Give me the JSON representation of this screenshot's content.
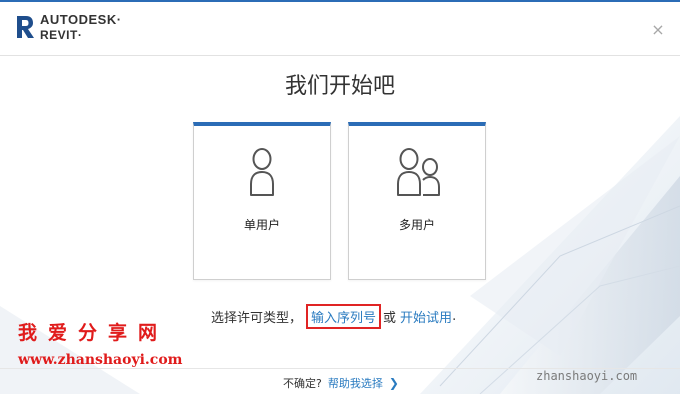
{
  "header": {
    "brand_line1": "AUTODESK·",
    "brand_line2": "REVIT·",
    "close_glyph": "×",
    "accent_color": "#2b6cb6",
    "logo_icon": "revit-r-icon"
  },
  "main": {
    "title": "我们开始吧",
    "cards": [
      {
        "label": "单用户",
        "icon": "single-user-icon"
      },
      {
        "label": "多用户",
        "icon": "multi-user-icon"
      }
    ],
    "license": {
      "prefix": "选择许可类型，",
      "serial_link": "输入序列号",
      "or": "或",
      "trial_link": "开始试用",
      "suffix": "."
    }
  },
  "footer": {
    "question": "不确定?",
    "help_link": "帮助我选择",
    "chevron_glyph": "❯"
  },
  "watermarks": {
    "site_name": "我爱分享网",
    "url_left": "www.zhanshaoyi.com",
    "url_right": "zhanshaoyi.com",
    "color": "#e01b1b"
  }
}
